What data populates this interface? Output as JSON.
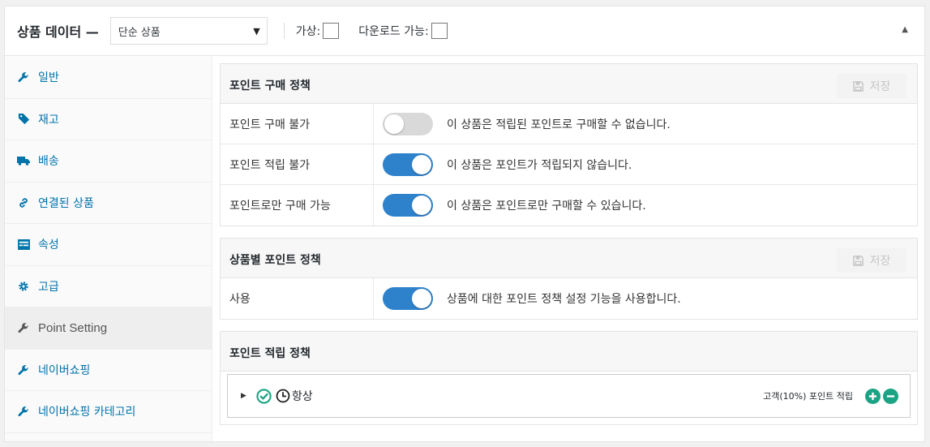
{
  "header": {
    "title": "상품 데이터 —",
    "product_type": "단순 상품",
    "virtual_label": "가상:",
    "downloadable_label": "다운로드 가능:"
  },
  "tabs": [
    {
      "label": "일반",
      "icon": "wrench-icon"
    },
    {
      "label": "재고",
      "icon": "tag-icon"
    },
    {
      "label": "배송",
      "icon": "truck-icon"
    },
    {
      "label": "연결된 상품",
      "icon": "link-icon"
    },
    {
      "label": "속성",
      "icon": "list-icon"
    },
    {
      "label": "고급",
      "icon": "gear-icon"
    },
    {
      "label": "Point Setting",
      "icon": "wrench-icon",
      "active": true
    },
    {
      "label": "네이버쇼핑",
      "icon": "wrench-icon"
    },
    {
      "label": "네이버쇼핑 카테고리",
      "icon": "wrench-icon"
    }
  ],
  "purchase_policy": {
    "title": "포인트 구매 정책",
    "save_label": "저장",
    "rows": [
      {
        "label": "포인트 구매 불가",
        "enabled": false,
        "desc": "이 상품은 적립된 포인트로 구매할 수 없습니다."
      },
      {
        "label": "포인트 적립 불가",
        "enabled": true,
        "desc": "이 상품은 포인트가 적립되지 않습니다."
      },
      {
        "label": "포인트로만 구매 가능",
        "enabled": true,
        "desc": "이 상품은 포인트로만 구매할 수 있습니다."
      }
    ]
  },
  "product_policy": {
    "title": "상품별 포인트 정책",
    "save_label": "저장",
    "rows": [
      {
        "label": "사용",
        "enabled": true,
        "desc": "상품에 대한 포인트 정책 설정 기능을 사용합니다."
      }
    ]
  },
  "earn_policy": {
    "title": "포인트 적립 정책",
    "rule_label": "항상",
    "rule_summary": "고객(10%) 포인트 적립"
  },
  "colors": {
    "accent": "#2e82cc",
    "link": "#0073aa",
    "green": "#1aa384"
  }
}
